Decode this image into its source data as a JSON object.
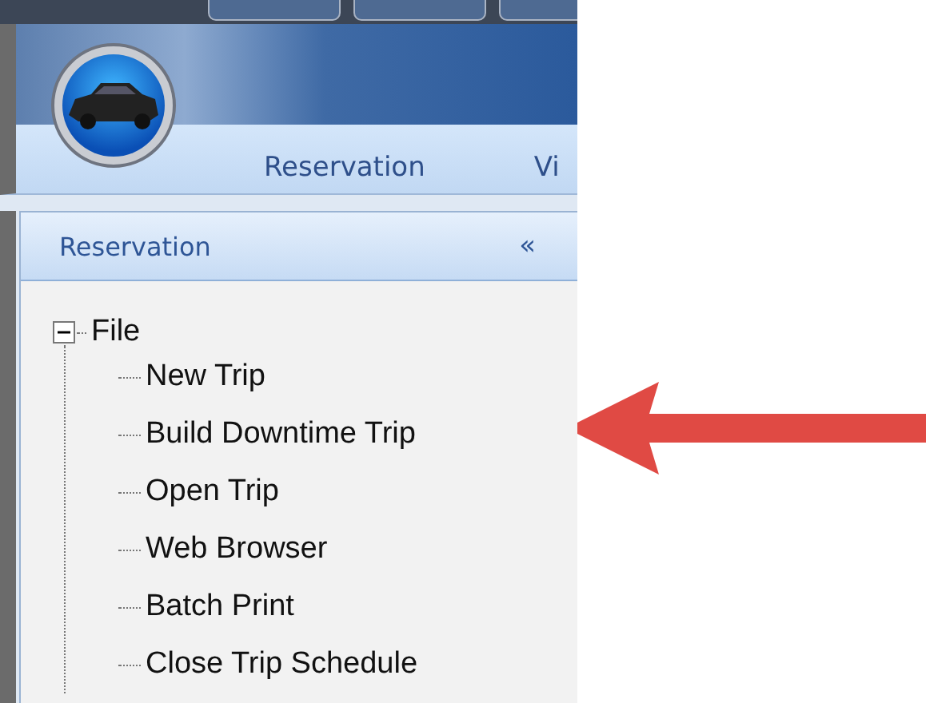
{
  "ribbon_tabs": [
    {
      "label": "Reservation"
    },
    {
      "label": "Vi"
    }
  ],
  "panel": {
    "title": "Reservation",
    "collapse_glyph": "«"
  },
  "tree": [
    {
      "label": "File",
      "expanded": true,
      "children": [
        {
          "label": "New Trip"
        },
        {
          "label": "Build Downtime Trip"
        },
        {
          "label": "Open Trip"
        },
        {
          "label": "Web Browser"
        },
        {
          "label": "Batch Print"
        },
        {
          "label": "Close Trip Schedule"
        }
      ]
    }
  ]
}
